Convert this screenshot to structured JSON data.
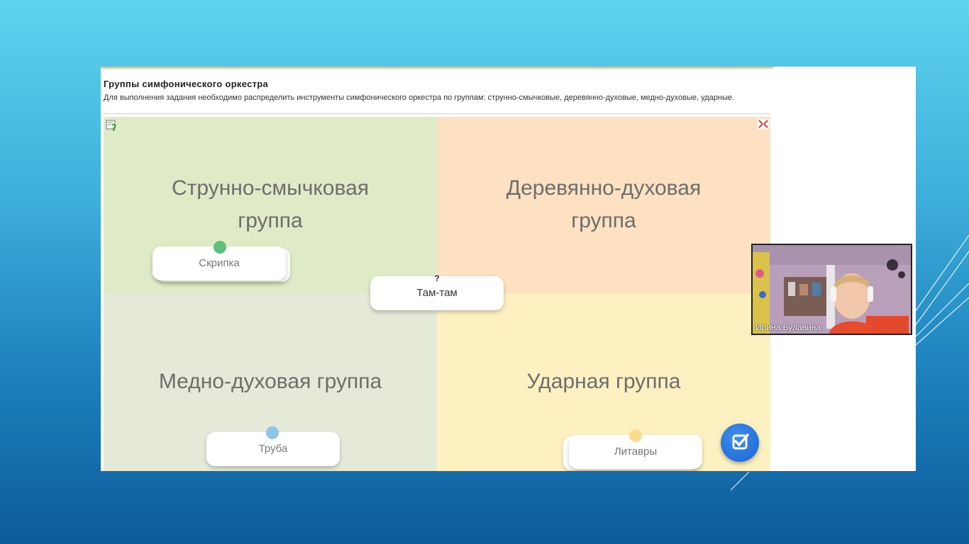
{
  "task": {
    "title": "Группы симфонического оркестра",
    "description": "Для выполнения задания необходимо распределить инструменты симфонического оркестра по группам: струнно-смычковые, деревянно-духовые, медно-духовые, ударные."
  },
  "groups": {
    "strings": "Струнно-смычковая группа",
    "woodwind": "Деревянно-духовая группа",
    "brass": "Медно-духовая группа",
    "percussion": "Ударная группа"
  },
  "cards": {
    "violin": "Скрипка",
    "tamtam": "Там-там",
    "tamtam_mark": "?",
    "trumpet": "Труба",
    "timpani": "Литавры"
  },
  "webcam": {
    "name": "Ирина Булавина"
  },
  "colors": {
    "strings_bg": "#dfebc6",
    "woodwind_bg": "#fde1c1",
    "brass_bg": "#e4ead7",
    "percussion_bg": "#fdf1c2",
    "strings_dot": "#5cbf7a",
    "brass_dot": "#8ec3ea",
    "percussion_dot": "#fbdc8a",
    "check_button": "#2a78e4"
  },
  "icons": {
    "help": "help-icon",
    "fullscreen": "fullscreen-toggle-icon",
    "check": "check-icon"
  }
}
